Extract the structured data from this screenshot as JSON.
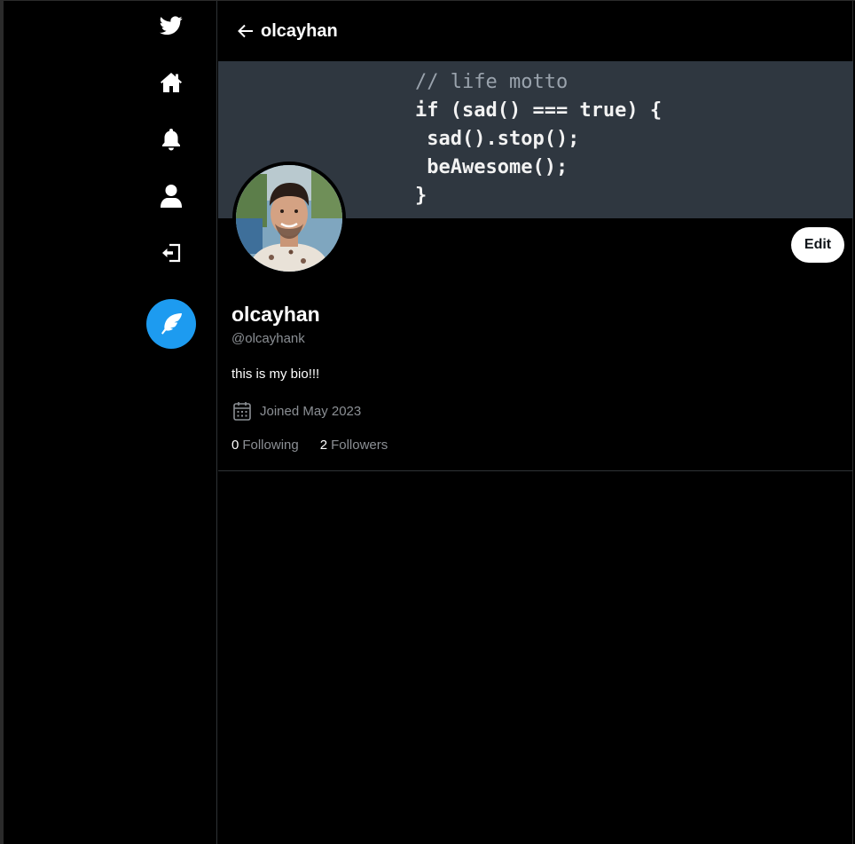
{
  "topbar": {
    "title": "olcayhan"
  },
  "banner": {
    "code_lines": [
      "// life motto",
      "if (sad() === true) {",
      " sad().stop();",
      " beAwesome();",
      "}"
    ]
  },
  "profile": {
    "name": "olcayhan",
    "handle": "@olcayhank",
    "bio": "this is my bio!!!",
    "joined": "Joined May 2023",
    "following_count": "0",
    "following_label": "Following",
    "followers_count": "2",
    "followers_label": "Followers",
    "edit_label": "Edit"
  },
  "sidebar": {
    "items": [
      {
        "icon": "twitter-logo-icon"
      },
      {
        "icon": "home-icon"
      },
      {
        "icon": "bell-icon"
      },
      {
        "icon": "user-icon"
      },
      {
        "icon": "logout-icon"
      }
    ],
    "tweet_button_icon": "feather-icon"
  },
  "colors": {
    "accent": "#1d9bf0",
    "background": "#000000",
    "banner": "#2f3740",
    "muted_text": "#8b8f94"
  }
}
